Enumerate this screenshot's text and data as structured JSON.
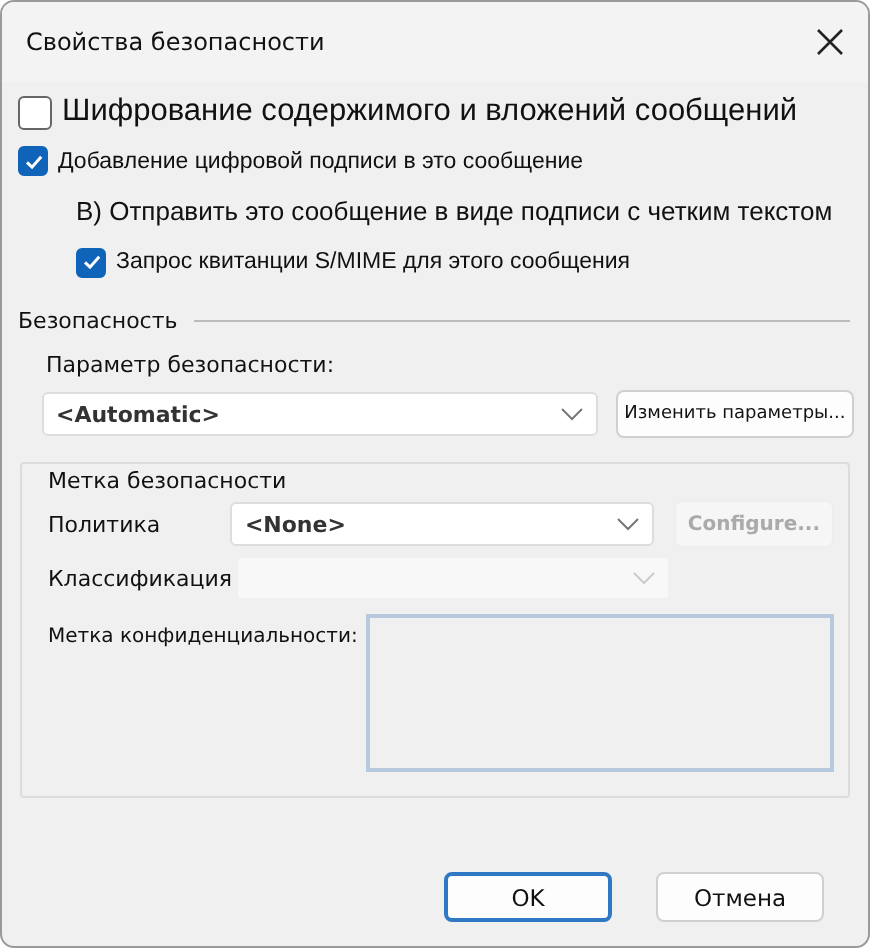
{
  "window": {
    "title": "Свойства безопасности"
  },
  "options": [
    {
      "kind": "large-checkbox",
      "label": "Шифрование содержимого и вложений сообщений",
      "checked": false,
      "indented": false
    },
    {
      "kind": "checkbox",
      "label": "Добавление цифровой подписи в это сообщение",
      "checked": true,
      "indented": false
    },
    {
      "kind": "text",
      "label": "B) Отправить это сообщение в виде подписи с четким текстом",
      "indented": true
    },
    {
      "kind": "checkbox",
      "label": "Запрос квитанции S/MIME для этого сообщения",
      "checked": true,
      "indented": true
    }
  ],
  "security": {
    "heading": "Безопасность",
    "setting_label": "Параметр безопасности:",
    "setting_value": "<Automatic>",
    "change_button": "Изменить параметры..."
  },
  "security_label": {
    "heading": "Метка безопасности",
    "policy": {
      "label": "Политика",
      "value": "<None>",
      "disabled": false
    },
    "configure_button": {
      "label": "Configure...",
      "disabled": true
    },
    "classification": {
      "label": "Классификация",
      "disabled": true
    },
    "privacy_label": "Метка конфиденциальности:"
  },
  "buttons": [
    {
      "label": "OK",
      "default": true
    },
    {
      "label": "Отмена",
      "default": false
    }
  ]
}
